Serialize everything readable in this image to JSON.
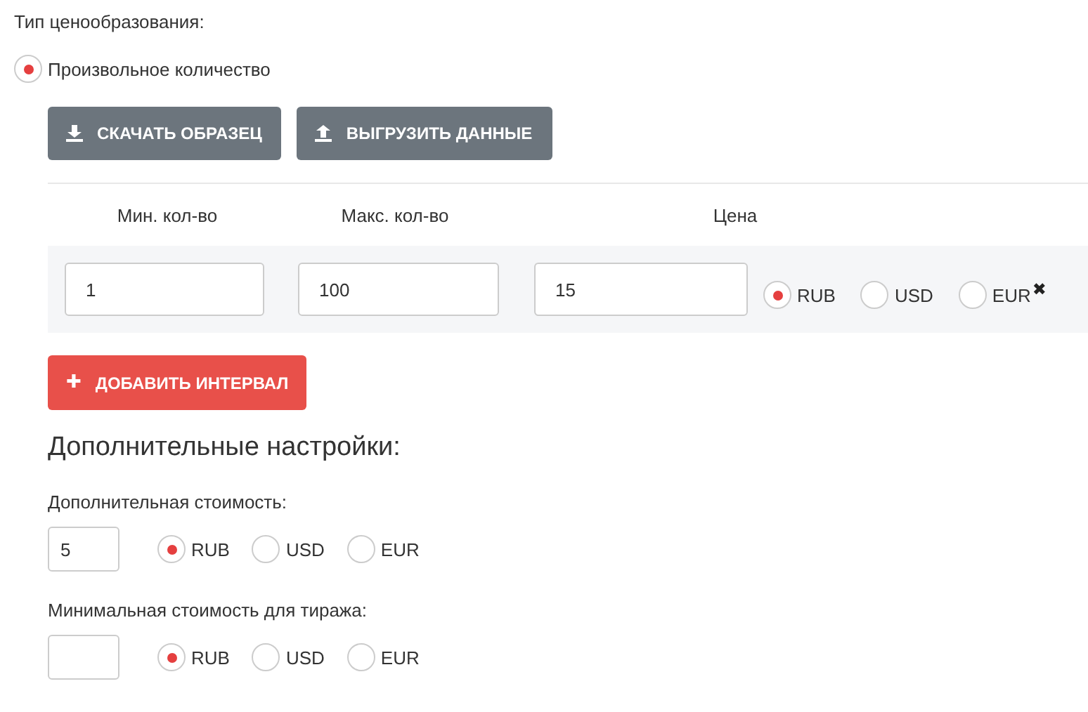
{
  "pricing_type": {
    "label": "Тип ценообразования:",
    "option": {
      "label": "Произвольное количество",
      "selected": true
    }
  },
  "buttons": [
    {
      "label": "СКАЧАТЬ ОБРАЗЕЦ",
      "kind": "download"
    },
    {
      "label": "ВЫГРУЗИТЬ ДАННЫЕ",
      "kind": "upload"
    }
  ],
  "table": {
    "columns": [
      "Мин. кол-во",
      "Макс. кол-во",
      "Цена"
    ],
    "rows": [
      {
        "min": "1",
        "max": "100",
        "price": "15",
        "currencies": [
          {
            "label": "RUB",
            "selected": true
          },
          {
            "label": "USD",
            "selected": false
          },
          {
            "label": "EUR",
            "selected": false
          }
        ],
        "remove": "✖"
      }
    ]
  },
  "add_button": {
    "label": "ДОБАВИТЬ ИНТЕРВАЛ",
    "icon": "✚"
  },
  "extra": {
    "title": "Дополнительные настройки:",
    "fields": [
      {
        "label": "Дополнительная стоимость:",
        "value": "5",
        "currencies": [
          {
            "label": "RUB",
            "selected": true
          },
          {
            "label": "USD",
            "selected": false
          },
          {
            "label": "EUR",
            "selected": false
          }
        ]
      },
      {
        "label": "Минимальная стоимость для тиража:",
        "currencies": [
          {
            "label": "RUB",
            "selected": true
          },
          {
            "label": "USD",
            "selected": false
          },
          {
            "label": "EUR",
            "selected": false
          }
        ]
      }
    ]
  }
}
